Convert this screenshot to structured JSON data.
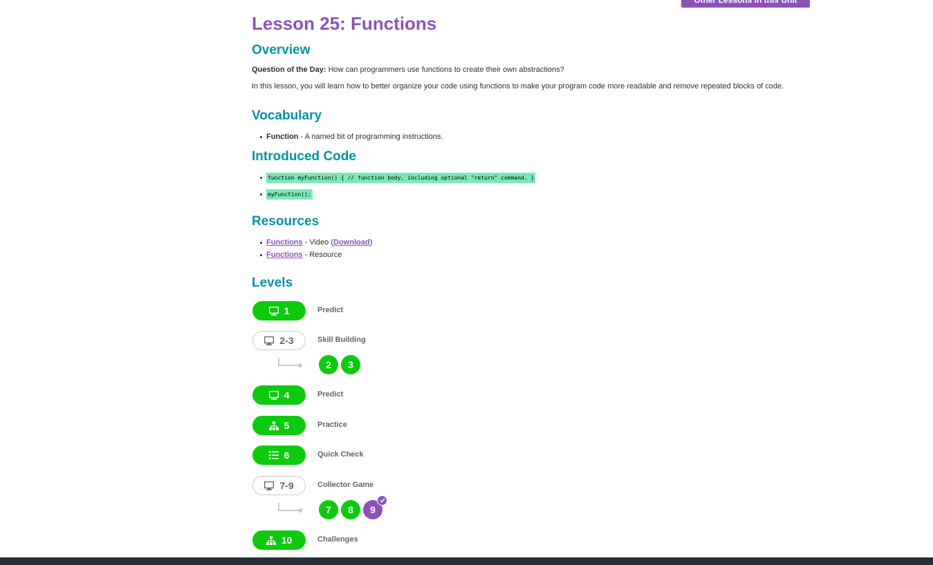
{
  "top_button": {
    "label": "Other Lessons in this Unit"
  },
  "lesson": {
    "title": "Lesson 25: Functions"
  },
  "overview": {
    "heading": "Overview",
    "question_label": "Question of the Day:",
    "question_text": " How can programmers use functions to create their own abstractions?",
    "description": "In this lesson, you will learn how to better organize your code using functions to make your program code more readable and remove repeated blocks of code."
  },
  "vocabulary": {
    "heading": "Vocabulary",
    "items": [
      {
        "term": "Function",
        "definition": " - A named bit of programming instructions."
      }
    ]
  },
  "introduced_code": {
    "heading": "Introduced Code",
    "items": [
      "function myFunction() { // function body, including optional \"return\" command. }",
      "myFunction();"
    ]
  },
  "resources": {
    "heading": "Resources",
    "items": [
      {
        "link": "Functions",
        "text_before": " - Video (",
        "sublink": "Download",
        "text_after": ")"
      },
      {
        "link": "Functions",
        "text_before": " - Resource"
      }
    ]
  },
  "levels": {
    "heading": "Levels",
    "rows": [
      {
        "label": "1",
        "name": "Predict",
        "icon": "desktop-icon",
        "style": "filled"
      },
      {
        "label": "2-3",
        "name": "Skill Building",
        "icon": "desktop-icon",
        "style": "outline",
        "sublevels": [
          "2",
          "3"
        ]
      },
      {
        "label": "4",
        "name": "Predict",
        "icon": "desktop-icon",
        "style": "filled"
      },
      {
        "label": "5",
        "name": "Practice",
        "icon": "sitemap-icon",
        "style": "filled"
      },
      {
        "label": "6",
        "name": "Quick Check",
        "icon": "list-icon",
        "style": "filled"
      },
      {
        "label": "7-9",
        "name": "Collector Game",
        "icon": "desktop-icon",
        "style": "outline",
        "sublevels": [
          "7",
          "8",
          "9"
        ],
        "current": "9"
      },
      {
        "label": "10",
        "name": "Challenges",
        "icon": "sitemap-icon",
        "style": "filled"
      }
    ]
  },
  "colors": {
    "purple": "#8c52ba",
    "teal": "#0093a4",
    "green": "#0eca0e",
    "code_bg": "#7de8b7"
  }
}
